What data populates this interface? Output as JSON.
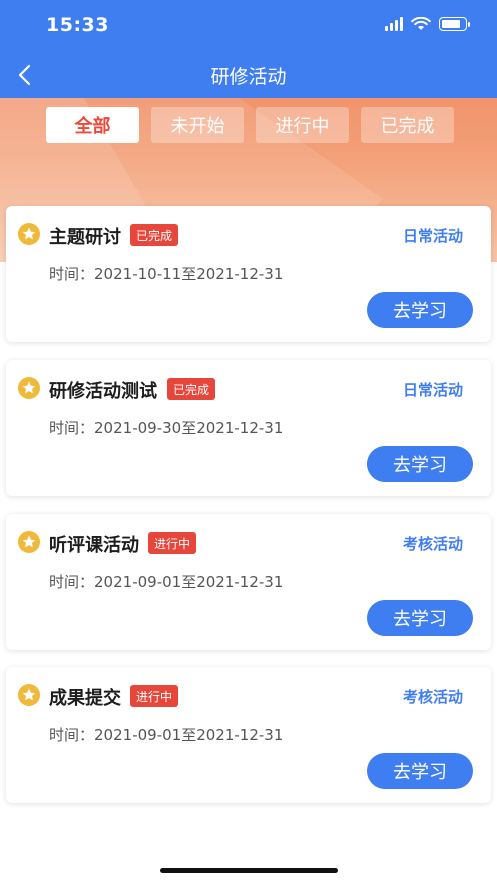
{
  "status_bar": {
    "time": "15:33"
  },
  "nav": {
    "title": "研修活动"
  },
  "tabs": [
    {
      "label": "全部",
      "active": true
    },
    {
      "label": "未开始",
      "active": false
    },
    {
      "label": "进行中",
      "active": false
    },
    {
      "label": "已完成",
      "active": false
    }
  ],
  "activities": [
    {
      "title": "主题研讨",
      "status": "已完成",
      "type": "日常活动",
      "time_label": "时间：",
      "time": "2021-10-11至2021-12-31",
      "action": "去学习"
    },
    {
      "title": "研修活动测试",
      "status": "已完成",
      "type": "日常活动",
      "time_label": "时间：",
      "time": "2021-09-30至2021-12-31",
      "action": "去学习"
    },
    {
      "title": "听评课活动",
      "status": "进行中",
      "type": "考核活动",
      "time_label": "时间：",
      "time": "2021-09-01至2021-12-31",
      "action": "去学习"
    },
    {
      "title": "成果提交",
      "status": "进行中",
      "type": "考核活动",
      "time_label": "时间：",
      "time": "2021-09-01至2021-12-31",
      "action": "去学习"
    }
  ],
  "colors": {
    "primary": "#3f7ef0",
    "accent": "#ee4a3a",
    "badge": "#e7473b",
    "star": "#f0b93a"
  }
}
